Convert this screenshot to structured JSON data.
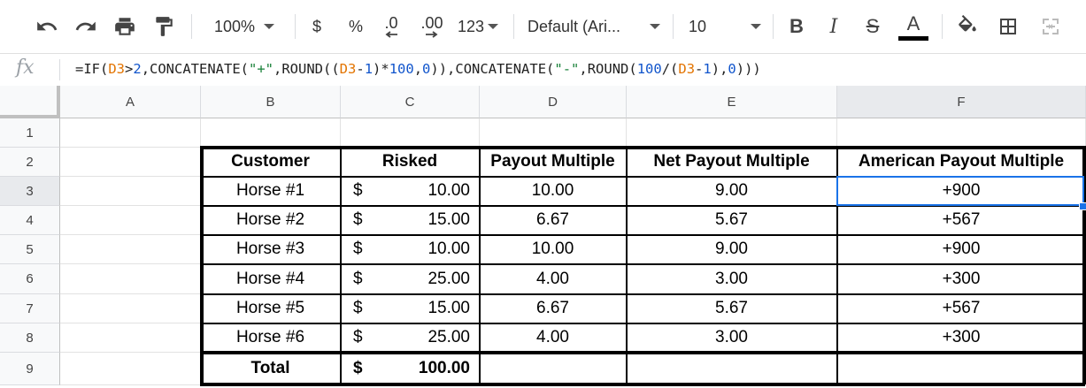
{
  "toolbar": {
    "zoom": "100%",
    "currency": "$",
    "percent": "%",
    "decrease_decimals": ".0",
    "increase_decimals": ".00",
    "more_formats": "123",
    "font": "Default (Ari...",
    "font_size": "10",
    "bold": "B",
    "italic": "I",
    "strikethrough": "S",
    "text_color_letter": "A"
  },
  "formula_bar": {
    "fx": "fx",
    "parts": [
      {
        "t": "=IF(",
        "c": ""
      },
      {
        "t": "D3",
        "c": "ref"
      },
      {
        "t": ">",
        "c": ""
      },
      {
        "t": "2",
        "c": "num"
      },
      {
        "t": ",CONCATENATE(",
        "c": ""
      },
      {
        "t": "\"+\"",
        "c": "str"
      },
      {
        "t": ",ROUND((",
        "c": ""
      },
      {
        "t": "D3",
        "c": "ref"
      },
      {
        "t": "-",
        "c": ""
      },
      {
        "t": "1",
        "c": "num"
      },
      {
        "t": ")*",
        "c": ""
      },
      {
        "t": "100",
        "c": "num"
      },
      {
        "t": ",",
        "c": ""
      },
      {
        "t": "0",
        "c": "num"
      },
      {
        "t": ")),CONCATENATE(",
        "c": ""
      },
      {
        "t": "\"-\"",
        "c": "str"
      },
      {
        "t": ",ROUND(",
        "c": ""
      },
      {
        "t": "100",
        "c": "num"
      },
      {
        "t": "/(",
        "c": ""
      },
      {
        "t": "D3",
        "c": "ref"
      },
      {
        "t": "-",
        "c": ""
      },
      {
        "t": "1",
        "c": "num"
      },
      {
        "t": "),",
        "c": ""
      },
      {
        "t": "0",
        "c": "num"
      },
      {
        "t": ")))",
        "c": ""
      }
    ]
  },
  "columns": [
    "A",
    "B",
    "C",
    "D",
    "E",
    "F"
  ],
  "rows": [
    "1",
    "2",
    "3",
    "4",
    "5",
    "6",
    "7",
    "8",
    "9"
  ],
  "table": {
    "headers": [
      "Customer",
      "Risked",
      "Payout Multiple",
      "Net Payout Multiple",
      "American Payout Multiple"
    ],
    "currency_symbol": "$",
    "data": [
      [
        "Horse #1",
        "10.00",
        "10.00",
        "9.00",
        "+900"
      ],
      [
        "Horse #2",
        "15.00",
        "6.67",
        "5.67",
        "+567"
      ],
      [
        "Horse #3",
        "10.00",
        "10.00",
        "9.00",
        "+900"
      ],
      [
        "Horse #4",
        "25.00",
        "4.00",
        "3.00",
        "+300"
      ],
      [
        "Horse #5",
        "15.00",
        "6.67",
        "5.67",
        "+567"
      ],
      [
        "Horse #6",
        "25.00",
        "4.00",
        "3.00",
        "+300"
      ]
    ],
    "total_label": "Total",
    "total_value": "100.00"
  },
  "active_cell": "F3",
  "colors": {
    "selection": "#1a73e8",
    "formula_ref": "#e37400",
    "formula_number": "#1155cc",
    "formula_string": "#188038"
  }
}
